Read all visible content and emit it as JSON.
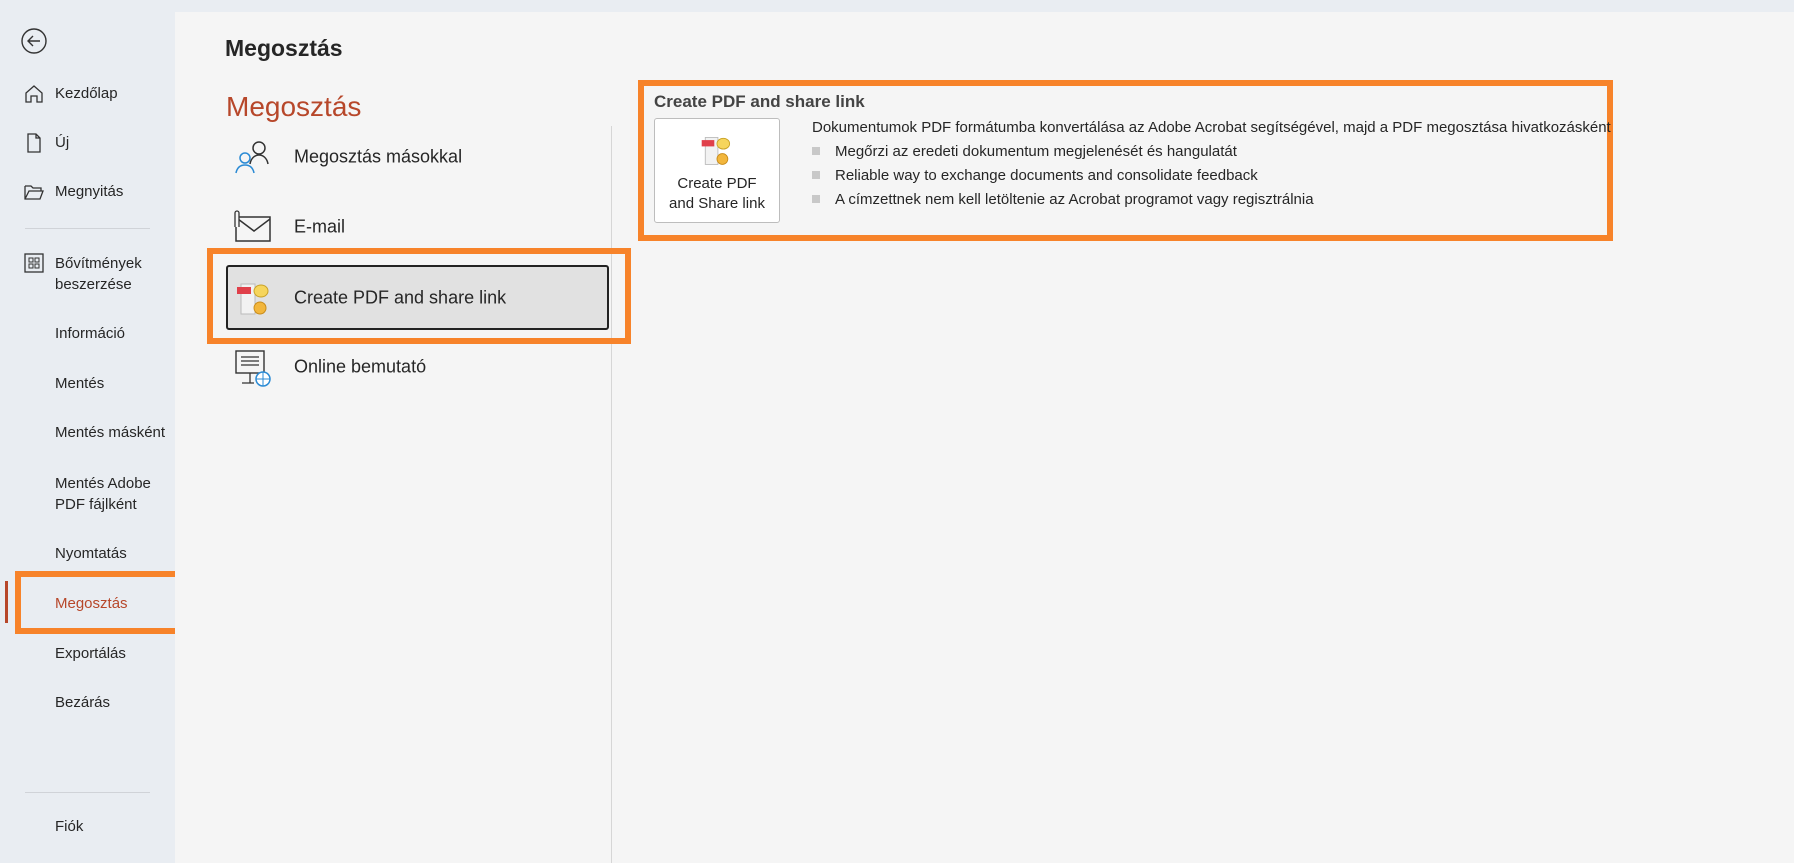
{
  "sidebar": {
    "back_icon": "back-arrow-circle-icon",
    "items": [
      {
        "label": "Kezdőlap",
        "icon": "home-icon"
      },
      {
        "label": "Új",
        "icon": "new-document-icon"
      },
      {
        "label": "Megnyitás",
        "icon": "folder-open-icon"
      },
      {
        "label": "Bővítmények beszerzése",
        "icon": "addins-grid-icon"
      },
      {
        "label": "Információ"
      },
      {
        "label": "Mentés"
      },
      {
        "label": "Mentés másként"
      },
      {
        "label": "Mentés Adobe PDF fájlként"
      },
      {
        "label": "Nyomtatás"
      },
      {
        "label": "Megosztás",
        "selected": true
      },
      {
        "label": "Exportálás"
      },
      {
        "label": "Bezárás"
      },
      {
        "label": "Fiók"
      }
    ]
  },
  "main": {
    "page_title": "Megosztás",
    "section_title": "Megosztás",
    "options": [
      {
        "label": "Megosztás másokkal",
        "icon": "share-people-icon"
      },
      {
        "label": "E-mail",
        "icon": "email-attachment-icon"
      },
      {
        "label": "Create PDF and share link",
        "icon": "pdf-share-icon",
        "selected": true
      },
      {
        "label": "Online bemutató",
        "icon": "online-presentation-icon"
      }
    ],
    "detail": {
      "title": "Create PDF and share link",
      "button_label_line1": "Create PDF",
      "button_label_line2": "and Share link",
      "description": "Dokumentumok PDF formátumba konvertálása az Adobe Acrobat segítségével, majd a PDF megosztása hivatkozásként",
      "bullets": [
        "Megőrzi az eredeti dokumentum megjelenését és hangulatát",
        "Reliable way to exchange documents and consolidate feedback",
        "A címzettnek nem kell letöltenie az Acrobat programot vagy regisztrálnia"
      ]
    }
  },
  "colors": {
    "accent": "#b7472a",
    "highlight": "#f7832a"
  }
}
